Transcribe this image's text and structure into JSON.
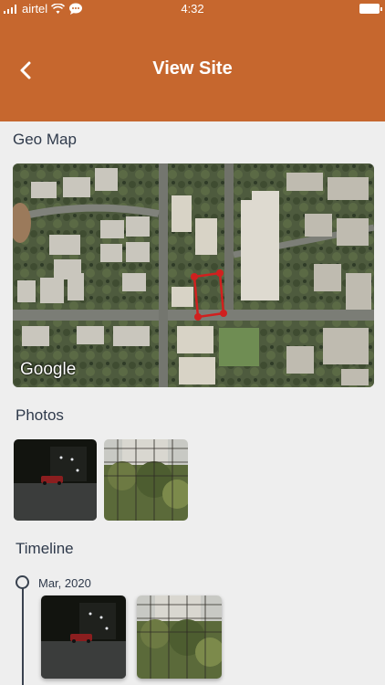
{
  "status_bar": {
    "carrier": "airtel",
    "time": "4:32",
    "icons": [
      "signal-icon",
      "wifi-icon",
      "chat-icon",
      "battery-icon"
    ]
  },
  "header": {
    "title": "View Site",
    "back_icon": "chevron-left-icon",
    "color": "#c6672e"
  },
  "sections": {
    "geo_map": "Geo Map",
    "photos": "Photos",
    "timeline": "Timeline"
  },
  "map": {
    "attribution": "Google",
    "boundary_color": "#d0201f"
  },
  "timeline": {
    "entries": [
      {
        "date": "Mar, 2020"
      }
    ]
  }
}
